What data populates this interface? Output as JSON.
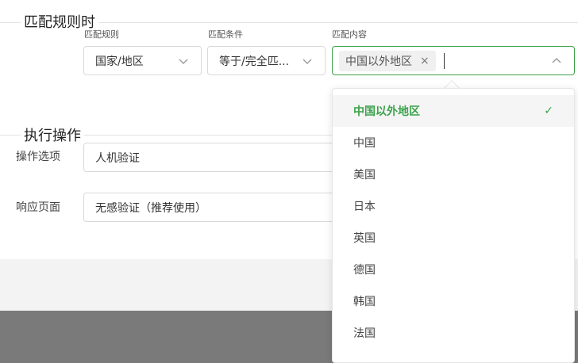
{
  "sections": {
    "match_title": "匹配规则时",
    "action_title": "执行操作"
  },
  "match": {
    "rule_label": "匹配规则",
    "rule_value": "国家/地区",
    "condition_label": "匹配条件",
    "condition_value": "等于/完全匹...",
    "content_label": "匹配内容",
    "selected_tag": "中国以外地区",
    "tag_remove": "×"
  },
  "action": {
    "option_label": "操作选项",
    "option_value": "人机验证",
    "response_label": "响应页面",
    "response_value": "无感验证（推荐使用）"
  },
  "dropdown": {
    "options": [
      "中国以外地区",
      "中国",
      "美国",
      "日本",
      "英国",
      "德国",
      "韩国",
      "法国"
    ],
    "selected_index": 0,
    "check": "✓"
  },
  "colors": {
    "accent": "#3aa34a",
    "overlay": "#7a7a7a"
  },
  "icons": {
    "dropdown_chevron": "chevron-down-icon",
    "open_chevron": "chevron-up-icon",
    "selected_mark": "check-icon",
    "tag_remove": "close-icon"
  }
}
